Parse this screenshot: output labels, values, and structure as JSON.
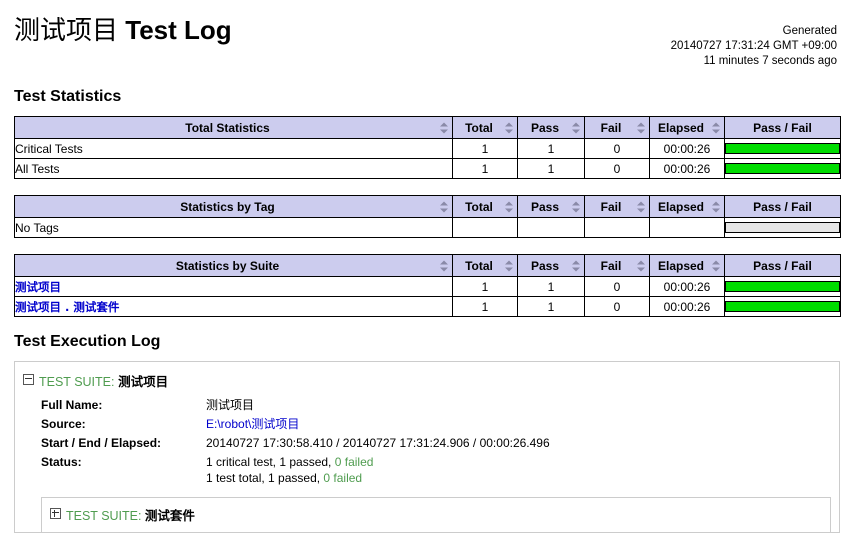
{
  "header": {
    "title_cjk": "测试项目",
    "title_en": "Test Log",
    "generated_label": "Generated",
    "generated_time": "20140727 17:31:24 GMT +09:00",
    "generated_ago": "11 minutes 7 seconds ago"
  },
  "statistics": {
    "heading": "Test Statistics",
    "columns": [
      "Total",
      "Pass",
      "Fail",
      "Elapsed",
      "Pass / Fail"
    ],
    "tables": [
      {
        "name_header": "Total Statistics",
        "rows": [
          {
            "name": "Critical Tests",
            "total": "1",
            "pass": "1",
            "fail": "0",
            "elapsed": "00:00:26",
            "pass_pct": 100,
            "link": false,
            "empty_bar": false
          },
          {
            "name": "All Tests",
            "total": "1",
            "pass": "1",
            "fail": "0",
            "elapsed": "00:00:26",
            "pass_pct": 100,
            "link": false,
            "empty_bar": false
          }
        ]
      },
      {
        "name_header": "Statistics by Tag",
        "rows": [
          {
            "name": "No Tags",
            "total": "",
            "pass": "",
            "fail": "",
            "elapsed": "",
            "pass_pct": 0,
            "link": false,
            "empty_bar": true
          }
        ]
      },
      {
        "name_header": "Statistics by Suite",
        "rows": [
          {
            "name": "测试项目",
            "total": "1",
            "pass": "1",
            "fail": "0",
            "elapsed": "00:00:26",
            "pass_pct": 100,
            "link": true,
            "empty_bar": false
          },
          {
            "name": "测试项目 . 测试套件",
            "total": "1",
            "pass": "1",
            "fail": "0",
            "elapsed": "00:00:26",
            "pass_pct": 100,
            "link": true,
            "empty_bar": false
          }
        ]
      }
    ]
  },
  "execution_log": {
    "heading": "Test Execution Log",
    "suite": {
      "type_label": "TEST SUITE:",
      "name": "测试项目",
      "toggle": "minus",
      "meta": [
        {
          "key": "Full Name:",
          "value": "测试项目",
          "kind": "text"
        },
        {
          "key": "Source:",
          "value": "E:\\robot\\测试项目",
          "kind": "link"
        },
        {
          "key": "Start / End / Elapsed:",
          "value": "20140727 17:30:58.410 / 20140727 17:31:24.906 / 00:00:26.496",
          "kind": "text"
        },
        {
          "key": "Status:",
          "kind": "status",
          "line1_a": "1 critical test, 1 passed, ",
          "line1_b": "0 failed",
          "line2_a": "1 test total, 1 passed, ",
          "line2_b": "0 failed"
        }
      ],
      "child": {
        "type_label": "TEST SUITE:",
        "name": "测试套件",
        "toggle": "plus"
      }
    }
  },
  "colors": {
    "pass_green": "#00dd00",
    "header_lavender": "#ccccee",
    "link_blue": "#0000cc",
    "label_green": "#4f9c4f",
    "empty_bar_gray": "#e6e6e6"
  }
}
